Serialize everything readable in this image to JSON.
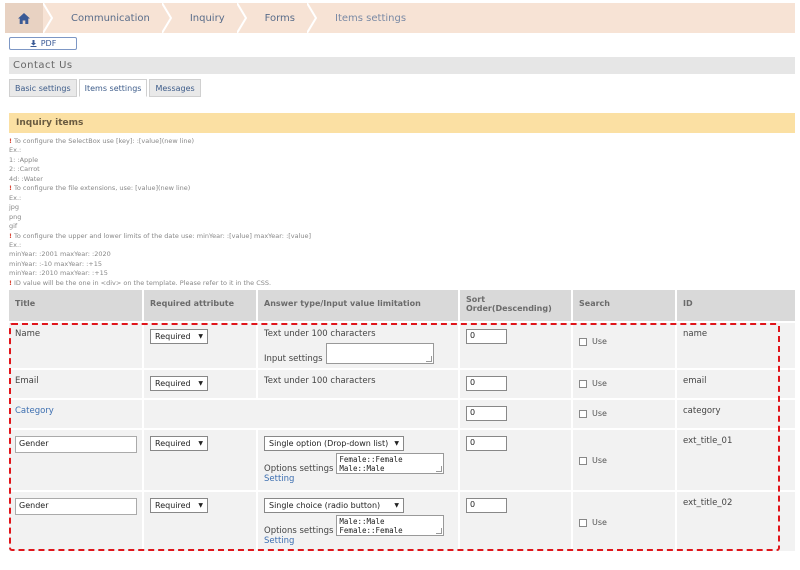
{
  "breadcrumb": {
    "items": [
      "Communication",
      "Inquiry",
      "Forms",
      "Items settings"
    ]
  },
  "toolbar": {
    "pdf_label": "PDF"
  },
  "page": {
    "title": "Contact Us"
  },
  "tabs": [
    {
      "label": "Basic settings",
      "active": false
    },
    {
      "label": "Items settings",
      "active": true
    },
    {
      "label": "Messages",
      "active": false
    }
  ],
  "section": {
    "title": "Inquiry items"
  },
  "notes": {
    "line1": "To configure the SelectBox use [key]: :[value](new line)",
    "line2": "Ex.:",
    "line3": "1: :Apple",
    "line4": "2: :Carrot",
    "line5": "4d: :Water",
    "line6": "To configure the file extensions, use: [value](new line)",
    "line7": "Ex.:",
    "line8": "jpg",
    "line9": "png",
    "line10": "gif",
    "line11": "To configure the upper and lower limits of the date use: minYear: :[value] maxYear: :[value]",
    "line12": "Ex.:",
    "line13": "minYear: :2001 maxYear: :2020",
    "line14": "minYear: :-10 maxYear: :+15",
    "line15": "minYear: :2010 maxYear: :+15",
    "line16": "ID value will be the one in <div> on the template. Please refer to it in the CSS."
  },
  "table": {
    "headers": {
      "title": "Title",
      "required": "Required attribute",
      "answer": "Answer type/Input value limitation",
      "sort": "Sort Order(Descending)",
      "search": "Search",
      "id": "ID"
    },
    "rows": [
      {
        "title": "Name",
        "required": "Required",
        "answer_text": "Text under 100 characters",
        "input_settings_label": "Input settings",
        "sort": "0",
        "search_label": "Use",
        "id": "name"
      },
      {
        "title": "Email",
        "required": "Required",
        "answer_text": "Text under 100 characters",
        "sort": "0",
        "search_label": "Use",
        "id": "email"
      },
      {
        "title": "Category",
        "sort": "0",
        "search_label": "Use",
        "id": "category"
      },
      {
        "title": "Gender",
        "required": "Required",
        "answer_type": "Single option (Drop-down list)",
        "options_label": "Options settings",
        "options_line1": "Female::Female",
        "options_line2": "Male::Male",
        "setting_link": "Setting",
        "sort": "0",
        "search_label": "Use",
        "id": "ext_title_01"
      },
      {
        "title": "Gender",
        "required": "Required",
        "answer_type": "Single choice (radio button)",
        "options_label": "Options settings",
        "options_line1": "Male::Male",
        "options_line2": "Female::Female",
        "setting_link": "Setting",
        "sort": "0",
        "search_label": "Use",
        "id": "ext_title_02"
      }
    ]
  },
  "colors": {
    "breadcrumb_bg": "#f7e3d5",
    "section_header_bg": "#fbe0a3",
    "highlight": "#e0151b",
    "link": "#3d6fb0"
  }
}
